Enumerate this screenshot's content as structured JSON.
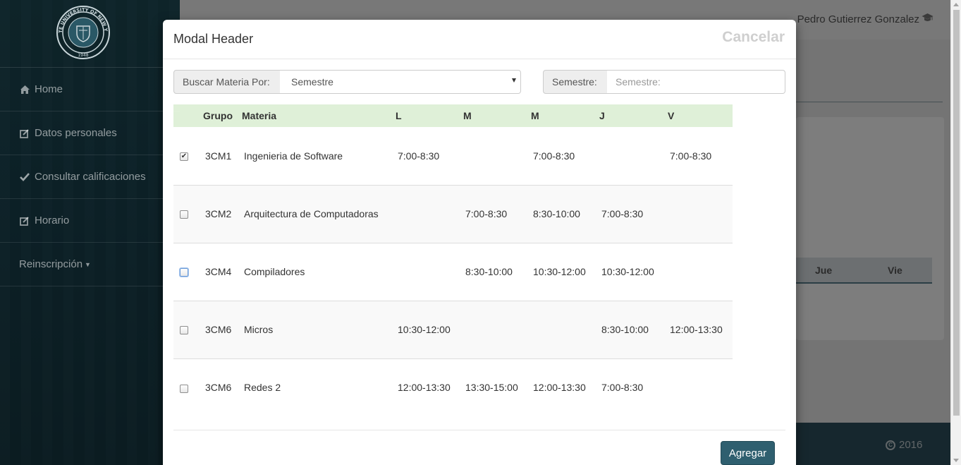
{
  "colors": {
    "sidebar": "#1a4350",
    "footer": "#2c4f5c",
    "header_row": "#dff0d8",
    "primary_button": "#2f5f6f"
  },
  "sidebar": {
    "logo_icon": "university-seal",
    "seal_text": {
      "arc": "STATE UNIVERSITY OF NEW YORK",
      "year": "1948"
    },
    "items": [
      {
        "label": "Home",
        "icon": "home-icon"
      },
      {
        "label": "Datos personales",
        "icon": "edit-icon"
      },
      {
        "label": "Consultar calificaciones",
        "icon": "check-icon"
      },
      {
        "label": "Horario",
        "icon": "edit-icon"
      },
      {
        "label": "Reinscripción",
        "icon": "caret-down-icon"
      }
    ]
  },
  "topbar": {
    "user_name": "Pedro Gutierrez Gonzalez",
    "user_icon": "graduation-cap-icon"
  },
  "background_schedule": {
    "day_jue": "Jue",
    "day_vie": "Vie"
  },
  "footer": {
    "copyright_year": "2016"
  },
  "modal": {
    "title": "Modal Header",
    "cancel_label": "Cancelar",
    "search": {
      "by_label": "Buscar Materia Por:",
      "by_value": "Semestre",
      "semestre_label": "Semestre:",
      "semestre_placeholder": "Semestre:"
    },
    "table": {
      "headers": {
        "grupo": "Grupo",
        "materia": "Materia",
        "l": "L",
        "m1": "M",
        "m2": "M",
        "j": "J",
        "v": "V"
      },
      "rows": [
        {
          "checked": true,
          "grupo": "3CM1",
          "materia": "Ingenieria de Software",
          "l": "7:00-8:30",
          "m1": "",
          "m2": "7:00-8:30",
          "j": "",
          "v": "7:00-8:30"
        },
        {
          "checked": false,
          "grupo": "3CM2",
          "materia": "Arquitectura de Computadoras",
          "l": "",
          "m1": "7:00-8:30",
          "m2": "8:30-10:00",
          "j": "7:00-8:30",
          "v": ""
        },
        {
          "checked": false,
          "grupo": "3CM4",
          "materia": "Compiladores",
          "l": "",
          "m1": "8:30-10:00",
          "m2": "10:30-12:00",
          "j": "10:30-12:00",
          "v": ""
        },
        {
          "checked": false,
          "grupo": "3CM6",
          "materia": "Micros",
          "l": "10:30-12:00",
          "m1": "",
          "m2": "",
          "j": "8:30-10:00",
          "v": "12:00-13:30"
        },
        {
          "checked": false,
          "grupo": "3CM6",
          "materia": "Redes 2",
          "l": "12:00-13:30",
          "m1": "13:30-15:00",
          "m2": "12:00-13:30",
          "j": "7:00-8:30",
          "v": ""
        }
      ]
    },
    "add_label": "Agregar"
  }
}
